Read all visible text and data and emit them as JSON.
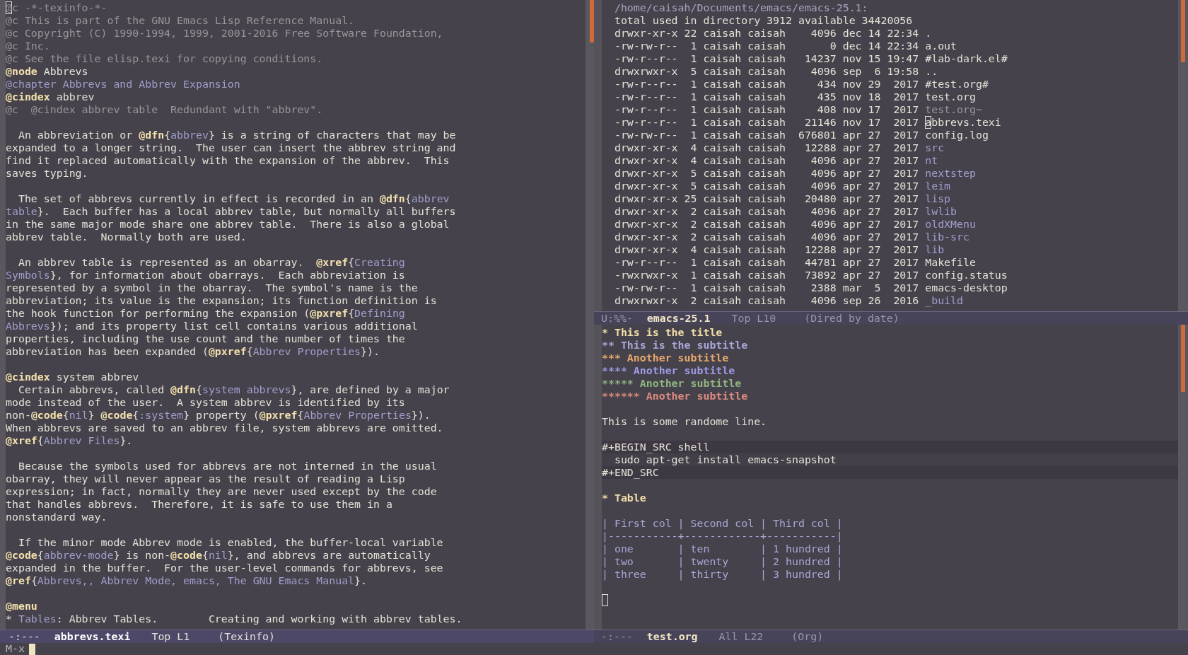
{
  "left_window": {
    "lines": [
      {
        "kind": "text",
        "spans": [
          {
            "kind": "comment",
            "text": "@",
            "cursor": true
          },
          {
            "kind": "comment",
            "text": "c -*-texinfo-*-"
          }
        ]
      },
      {
        "kind": "text",
        "spans": [
          {
            "kind": "comment",
            "text": "@c This is part of the GNU Emacs Lisp Reference Manual."
          }
        ]
      },
      {
        "kind": "text",
        "spans": [
          {
            "kind": "comment",
            "text": "@c Copyright (C) 1990-1994, 1999, 2001-2016 Free Software Foundation,"
          }
        ]
      },
      {
        "kind": "text",
        "spans": [
          {
            "kind": "comment",
            "text": "@c Inc."
          }
        ]
      },
      {
        "kind": "text",
        "spans": [
          {
            "kind": "comment",
            "text": "@c See the file elisp.texi for copying conditions."
          }
        ]
      },
      {
        "kind": "text",
        "spans": [
          {
            "kind": "keyword",
            "text": "@node"
          },
          {
            "text": " Abbrevs"
          }
        ]
      },
      {
        "kind": "text",
        "spans": [
          {
            "kind": "chapter",
            "text": "@chapter Abbrevs and Abbrev Expansion"
          }
        ]
      },
      {
        "kind": "text",
        "spans": [
          {
            "kind": "keyword",
            "text": "@cindex"
          },
          {
            "text": " abbrev"
          }
        ]
      },
      {
        "kind": "text",
        "spans": [
          {
            "kind": "comment",
            "text": "@c  @cindex abbrev table  Redundant with \"abbrev\"."
          }
        ]
      },
      {
        "kind": "blank"
      },
      {
        "kind": "text",
        "spans": [
          {
            "text": "  An abbreviation or "
          },
          {
            "kind": "keyword",
            "text": "@dfn"
          },
          {
            "text": "{"
          },
          {
            "kind": "link",
            "text": "abbrev"
          },
          {
            "text": "} is a string of characters that may be"
          }
        ]
      },
      {
        "kind": "text",
        "spans": [
          {
            "text": "expanded to a longer string.  The user can insert the abbrev string and"
          }
        ]
      },
      {
        "kind": "text",
        "spans": [
          {
            "text": "find it replaced automatically with the expansion of the abbrev.  This"
          }
        ]
      },
      {
        "kind": "text",
        "spans": [
          {
            "text": "saves typing."
          }
        ]
      },
      {
        "kind": "blank"
      },
      {
        "kind": "text",
        "spans": [
          {
            "text": "  The set of abbrevs currently in effect is recorded in an "
          },
          {
            "kind": "keyword",
            "text": "@dfn"
          },
          {
            "text": "{"
          },
          {
            "kind": "link",
            "text": "abbrev"
          }
        ]
      },
      {
        "kind": "text",
        "spans": [
          {
            "kind": "link",
            "text": "table"
          },
          {
            "text": "}.  Each buffer has a local abbrev table, but normally all buffers"
          }
        ]
      },
      {
        "kind": "text",
        "spans": [
          {
            "text": "in the same major mode share one abbrev table.  There is also a global"
          }
        ]
      },
      {
        "kind": "text",
        "spans": [
          {
            "text": "abbrev table.  Normally both are used."
          }
        ]
      },
      {
        "kind": "blank"
      },
      {
        "kind": "text",
        "spans": [
          {
            "text": "  An abbrev table is represented as an obarray.  "
          },
          {
            "kind": "keyword",
            "text": "@xref"
          },
          {
            "text": "{"
          },
          {
            "kind": "link",
            "text": "Creating"
          }
        ]
      },
      {
        "kind": "text",
        "spans": [
          {
            "kind": "link",
            "text": "Symbols"
          },
          {
            "text": "}, for information about obarrays.  Each abbreviation is"
          }
        ]
      },
      {
        "kind": "text",
        "spans": [
          {
            "text": "represented by a symbol in the obarray.  The symbol's name is the"
          }
        ]
      },
      {
        "kind": "text",
        "spans": [
          {
            "text": "abbreviation; its value is the expansion; its function definition is"
          }
        ]
      },
      {
        "kind": "text",
        "spans": [
          {
            "text": "the hook function for performing the expansion ("
          },
          {
            "kind": "keyword",
            "text": "@pxref"
          },
          {
            "text": "{"
          },
          {
            "kind": "link",
            "text": "Defining"
          }
        ]
      },
      {
        "kind": "text",
        "spans": [
          {
            "kind": "link",
            "text": "Abbrevs"
          },
          {
            "text": "}); and its property list cell contains various additional"
          }
        ]
      },
      {
        "kind": "text",
        "spans": [
          {
            "text": "properties, including the use count and the number of times the"
          }
        ]
      },
      {
        "kind": "text",
        "spans": [
          {
            "text": "abbreviation has been expanded ("
          },
          {
            "kind": "keyword",
            "text": "@pxref"
          },
          {
            "text": "{"
          },
          {
            "kind": "link",
            "text": "Abbrev Properties"
          },
          {
            "text": "})."
          }
        ]
      },
      {
        "kind": "blank"
      },
      {
        "kind": "text",
        "spans": [
          {
            "kind": "keyword",
            "text": "@cindex"
          },
          {
            "text": " system abbrev"
          }
        ]
      },
      {
        "kind": "text",
        "spans": [
          {
            "text": "  Certain abbrevs, called "
          },
          {
            "kind": "keyword",
            "text": "@dfn"
          },
          {
            "text": "{"
          },
          {
            "kind": "link",
            "text": "system abbrevs"
          },
          {
            "text": "}, are defined by a major"
          }
        ]
      },
      {
        "kind": "text",
        "spans": [
          {
            "text": "mode instead of the user.  A system abbrev is identified by its"
          }
        ]
      },
      {
        "kind": "text",
        "spans": [
          {
            "text": "non-"
          },
          {
            "kind": "keyword",
            "text": "@code"
          },
          {
            "text": "{"
          },
          {
            "kind": "link",
            "text": "nil"
          },
          {
            "text": "} "
          },
          {
            "kind": "keyword",
            "text": "@code"
          },
          {
            "text": "{"
          },
          {
            "kind": "link",
            "text": ":system"
          },
          {
            "text": "} property ("
          },
          {
            "kind": "keyword",
            "text": "@pxref"
          },
          {
            "text": "{"
          },
          {
            "kind": "link",
            "text": "Abbrev Properties"
          },
          {
            "text": "})."
          }
        ]
      },
      {
        "kind": "text",
        "spans": [
          {
            "text": "When abbrevs are saved to an abbrev file, system abbrevs are omitted."
          }
        ]
      },
      {
        "kind": "text",
        "spans": [
          {
            "kind": "keyword",
            "text": "@xref"
          },
          {
            "text": "{"
          },
          {
            "kind": "link",
            "text": "Abbrev Files"
          },
          {
            "text": "}."
          }
        ]
      },
      {
        "kind": "blank"
      },
      {
        "kind": "text",
        "spans": [
          {
            "text": "  Because the symbols used for abbrevs are not interned in the usual"
          }
        ]
      },
      {
        "kind": "text",
        "spans": [
          {
            "text": "obarray, they will never appear as the result of reading a Lisp"
          }
        ]
      },
      {
        "kind": "text",
        "spans": [
          {
            "text": "expression; in fact, normally they are never used except by the code"
          }
        ]
      },
      {
        "kind": "text",
        "spans": [
          {
            "text": "that handles abbrevs.  Therefore, it is safe to use them in a"
          }
        ]
      },
      {
        "kind": "text",
        "spans": [
          {
            "text": "nonstandard way."
          }
        ]
      },
      {
        "kind": "blank"
      },
      {
        "kind": "text",
        "spans": [
          {
            "text": "  If the minor mode Abbrev mode is enabled, the buffer-local variable"
          }
        ]
      },
      {
        "kind": "text",
        "spans": [
          {
            "kind": "keyword",
            "text": "@code"
          },
          {
            "text": "{"
          },
          {
            "kind": "link",
            "text": "abbrev-mode"
          },
          {
            "text": "} is non-"
          },
          {
            "kind": "keyword",
            "text": "@code"
          },
          {
            "text": "{"
          },
          {
            "kind": "link",
            "text": "nil"
          },
          {
            "text": "}, and abbrevs are automatically"
          }
        ]
      },
      {
        "kind": "text",
        "spans": [
          {
            "text": "expanded in the buffer.  For the user-level commands for abbrevs, see"
          }
        ]
      },
      {
        "kind": "text",
        "spans": [
          {
            "kind": "keyword",
            "text": "@ref"
          },
          {
            "text": "{"
          },
          {
            "kind": "link",
            "text": "Abbrevs,, Abbrev Mode, emacs, The GNU Emacs Manual"
          },
          {
            "text": "}."
          }
        ]
      },
      {
        "kind": "blank"
      },
      {
        "kind": "text",
        "spans": [
          {
            "kind": "keyword",
            "text": "@menu"
          }
        ]
      },
      {
        "kind": "text",
        "spans": [
          {
            "text": "* "
          },
          {
            "kind": "link",
            "text": "Tables"
          },
          {
            "text": ": Abbrev Tables.        Creating and working with abbrev tables."
          }
        ]
      }
    ],
    "mode_line": {
      "status": "-:---",
      "buffer": "abbrevs.texi",
      "position": "Top L1",
      "mode": "(Texinfo)",
      "active": true
    }
  },
  "dired_window": {
    "path": "/home/caisah/Documents/emacs/emacs-25.1:",
    "total": "total used in directory 3912 available 34420056",
    "entries": [
      {
        "perms": "drwxr-xr-x",
        "links": "22",
        "owner": "caisah",
        "group": "caisah",
        "size": "4096",
        "date": "dec 14 22:34",
        "name": ".",
        "kind": "plain",
        "cursor": false
      },
      {
        "perms": "-rw-rw-r--",
        "links": "1",
        "owner": "caisah",
        "group": "caisah",
        "size": "0",
        "date": "dec 14 22:34",
        "name": "a.out",
        "kind": "plain",
        "cursor": false
      },
      {
        "perms": "-rw-r--r--",
        "links": "1",
        "owner": "caisah",
        "group": "caisah",
        "size": "14237",
        "date": "nov 15 19:47",
        "name": "#lab-dark.el#",
        "kind": "plain",
        "cursor": false
      },
      {
        "perms": "drwxrwxr-x",
        "links": "5",
        "owner": "caisah",
        "group": "caisah",
        "size": "4096",
        "date": "sep  6 19:58",
        "name": "..",
        "kind": "plain",
        "cursor": false
      },
      {
        "perms": "-rw-r--r--",
        "links": "1",
        "owner": "caisah",
        "group": "caisah",
        "size": "434",
        "date": "nov 29  2017",
        "name": "#test.org#",
        "kind": "plain",
        "cursor": false
      },
      {
        "perms": "-rw-r--r--",
        "links": "1",
        "owner": "caisah",
        "group": "caisah",
        "size": "435",
        "date": "nov 18  2017",
        "name": "test.org",
        "kind": "plain",
        "cursor": false
      },
      {
        "perms": "-rw-r--r--",
        "links": "1",
        "owner": "caisah",
        "group": "caisah",
        "size": "408",
        "date": "nov 17  2017",
        "name": "test.org~",
        "kind": "backup",
        "cursor": false
      },
      {
        "perms": "-rw-r--r--",
        "links": "1",
        "owner": "caisah",
        "group": "caisah",
        "size": "21146",
        "date": "nov 17  2017",
        "name": "abbrevs.texi",
        "kind": "plain",
        "cursor": true
      },
      {
        "perms": "-rw-rw-r--",
        "links": "1",
        "owner": "caisah",
        "group": "caisah",
        "size": "676801",
        "date": "apr 27  2017",
        "name": "config.log",
        "kind": "plain",
        "cursor": false
      },
      {
        "perms": "drwxr-xr-x",
        "links": "4",
        "owner": "caisah",
        "group": "caisah",
        "size": "12288",
        "date": "apr 27  2017",
        "name": "src",
        "kind": "directory",
        "cursor": false
      },
      {
        "perms": "drwxr-xr-x",
        "links": "4",
        "owner": "caisah",
        "group": "caisah",
        "size": "4096",
        "date": "apr 27  2017",
        "name": "nt",
        "kind": "directory",
        "cursor": false
      },
      {
        "perms": "drwxr-xr-x",
        "links": "5",
        "owner": "caisah",
        "group": "caisah",
        "size": "4096",
        "date": "apr 27  2017",
        "name": "nextstep",
        "kind": "directory",
        "cursor": false
      },
      {
        "perms": "drwxr-xr-x",
        "links": "5",
        "owner": "caisah",
        "group": "caisah",
        "size": "4096",
        "date": "apr 27  2017",
        "name": "leim",
        "kind": "directory",
        "cursor": false
      },
      {
        "perms": "drwxr-xr-x",
        "links": "25",
        "owner": "caisah",
        "group": "caisah",
        "size": "20480",
        "date": "apr 27  2017",
        "name": "lisp",
        "kind": "directory",
        "cursor": false
      },
      {
        "perms": "drwxr-xr-x",
        "links": "2",
        "owner": "caisah",
        "group": "caisah",
        "size": "4096",
        "date": "apr 27  2017",
        "name": "lwlib",
        "kind": "directory",
        "cursor": false
      },
      {
        "perms": "drwxr-xr-x",
        "links": "2",
        "owner": "caisah",
        "group": "caisah",
        "size": "4096",
        "date": "apr 27  2017",
        "name": "oldXMenu",
        "kind": "directory",
        "cursor": false
      },
      {
        "perms": "drwxr-xr-x",
        "links": "2",
        "owner": "caisah",
        "group": "caisah",
        "size": "4096",
        "date": "apr 27  2017",
        "name": "lib-src",
        "kind": "directory",
        "cursor": false
      },
      {
        "perms": "drwxr-xr-x",
        "links": "4",
        "owner": "caisah",
        "group": "caisah",
        "size": "12288",
        "date": "apr 27  2017",
        "name": "lib",
        "kind": "directory",
        "cursor": false
      },
      {
        "perms": "-rw-r--r--",
        "links": "1",
        "owner": "caisah",
        "group": "caisah",
        "size": "44781",
        "date": "apr 27  2017",
        "name": "Makefile",
        "kind": "plain",
        "cursor": false
      },
      {
        "perms": "-rwxrwxr-x",
        "links": "1",
        "owner": "caisah",
        "group": "caisah",
        "size": "73892",
        "date": "apr 27  2017",
        "name": "config.status",
        "kind": "plain",
        "cursor": false
      },
      {
        "perms": "-rw-rw-r--",
        "links": "1",
        "owner": "caisah",
        "group": "caisah",
        "size": "2388",
        "date": "mar  5  2017",
        "name": "emacs-desktop",
        "kind": "plain",
        "cursor": false
      },
      {
        "perms": "drwxrwxr-x",
        "links": "2",
        "owner": "caisah",
        "group": "caisah",
        "size": "4096",
        "date": "sep 26  2016",
        "name": "_build",
        "kind": "directory",
        "cursor": false
      }
    ],
    "mode_line": {
      "status": "U:%%-",
      "buffer": "emacs-25.1",
      "position": "Top L10",
      "mode": "(Dired by date)",
      "active": false
    }
  },
  "org_window": {
    "lines": [
      {
        "kind": "heading",
        "text": "* This is the title",
        "color": "#f0dfaa"
      },
      {
        "kind": "heading",
        "text": "** This is the subtitle",
        "color": "#a9a6d8"
      },
      {
        "kind": "heading",
        "text": "*** Another subtitle",
        "color": "#e8a86c"
      },
      {
        "kind": "heading",
        "text": "**** Another subtitle",
        "color": "#9d9ae6"
      },
      {
        "kind": "heading",
        "text": "***** Another subtitle",
        "color": "#8fb581"
      },
      {
        "kind": "heading",
        "text": "****** Another subtitle",
        "color": "#de8a80"
      },
      {
        "kind": "blank"
      },
      {
        "kind": "text",
        "text": "This is some randome line."
      },
      {
        "kind": "blank"
      },
      {
        "kind": "src_delimiter",
        "text": "#+BEGIN_SRC shell"
      },
      {
        "kind": "src_body",
        "text": "  sudo apt-get install emacs-snapshot"
      },
      {
        "kind": "src_delimiter",
        "text": "#+END_SRC"
      },
      {
        "kind": "blank"
      },
      {
        "kind": "heading",
        "text": "* Table",
        "color": "#f0dfaa"
      },
      {
        "kind": "blank"
      },
      {
        "kind": "table",
        "text": "| First col | Second col | Third col |"
      },
      {
        "kind": "table",
        "text": "|-----------+------------+-----------|"
      },
      {
        "kind": "table",
        "text": "| one       | ten        | 1 hundred |"
      },
      {
        "kind": "table",
        "text": "| two       | twenty     | 2 hundred |"
      },
      {
        "kind": "table",
        "text": "| three     | thirty     | 3 hundred |"
      },
      {
        "kind": "blank"
      },
      {
        "kind": "cursor"
      }
    ],
    "mode_line": {
      "status": "-:---",
      "buffer": "test.org",
      "position": "All L22",
      "mode": "(Org)",
      "active": false
    }
  },
  "minibuffer": {
    "prompt": "M-x"
  }
}
